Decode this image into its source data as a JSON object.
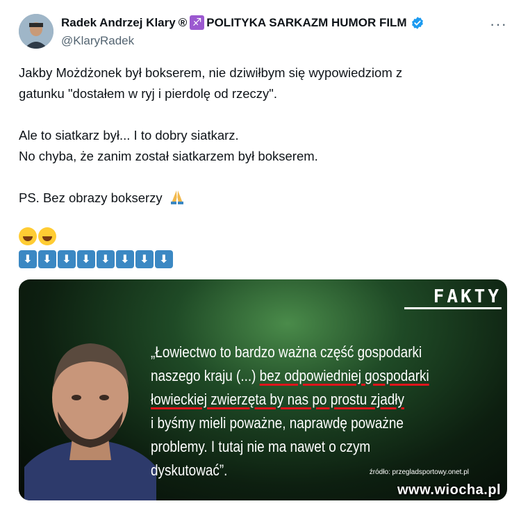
{
  "author": {
    "name": "Radek Andrzej Klary",
    "registered": "®",
    "zodiac_icon": "sagittarius-icon",
    "brand": "POLITYKA SARKAZM HUMOR FILM",
    "verified_icon": "verified-badge-icon",
    "handle": "@KlaryRadek"
  },
  "more_label": "···",
  "tweet": {
    "line1": "Jakby Możdżonek był bokserem, nie dziwiłbym się wypowiedziom z",
    "line2": "gatunku \"dostałem w ryj i pierdolę od rzeczy\".",
    "line3": "Ale to siatkarz był... I to dobry siatkarz.",
    "line4": "No chyba, że zanim został siatkarzem był bokserem.",
    "line5": "PS. Bez obrazy bokserzy",
    "line5_emoji": "praying-hands-icon"
  },
  "emoji_laugh_count": 2,
  "arrow_down_count": 8,
  "arrow_glyph": "⬇",
  "media": {
    "logo": "FAKTY",
    "quote_line1": "„Łowiectwo to bardzo ważna część gospodarki",
    "quote_line2a": "naszego kraju (...) ",
    "quote_line2b": "bez odpowiedniej gospodarki",
    "quote_line3": "łowieckiej zwierzęta by nas po prostu zjadły",
    "quote_line4": "i byśmy mieli poważne, naprawdę poważne",
    "quote_line5": "problemy. I tutaj nie ma nawet o czym dyskutować”.",
    "source": "źródło: przegladsportowy.onet.pl"
  },
  "watermark": "www.wiocha.pl",
  "colors": {
    "accent_blue": "#1d9bf0",
    "underline_red": "#e0141b",
    "muted": "#536471"
  }
}
